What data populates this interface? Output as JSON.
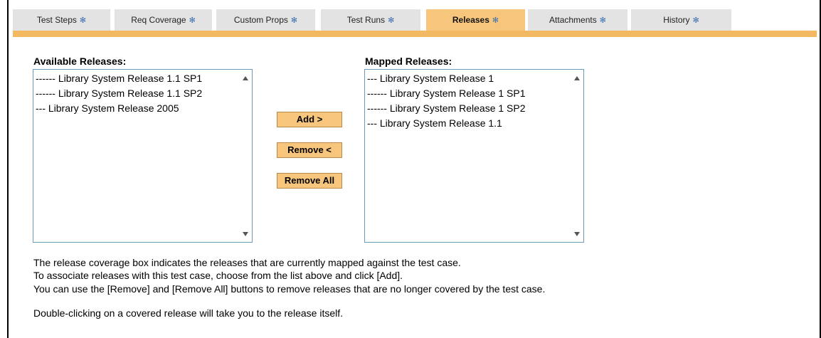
{
  "tabs": [
    {
      "label": "Test Steps",
      "active": false
    },
    {
      "label": "Req Coverage",
      "active": false
    },
    {
      "label": "Custom Props",
      "active": false
    },
    {
      "label": "Test Runs",
      "active": false
    },
    {
      "label": "Releases",
      "active": true
    },
    {
      "label": "Attachments",
      "active": false
    },
    {
      "label": "History",
      "active": false
    }
  ],
  "tab_marker": "✻",
  "available": {
    "label": "Available Releases:",
    "items": [
      "------ Library System Release 1.1 SP1",
      "------ Library System Release 1.1 SP2",
      "--- Library System Release 2005"
    ]
  },
  "mapped": {
    "label": "Mapped Releases:",
    "items": [
      "--- Library System Release 1",
      "------ Library System Release 1 SP1",
      "------ Library System Release 1 SP2",
      "--- Library System Release 1.1"
    ]
  },
  "buttons": {
    "add": "Add >",
    "remove": "Remove <",
    "remove_all": "Remove All"
  },
  "help": {
    "line1": "The release coverage box indicates the releases that are currently mapped against the test case.",
    "line2": "To associate releases with this test case, choose from the list above and click [Add].",
    "line3": "You can use the [Remove] and [Remove All] buttons to remove releases that are no longer covered by the test case.",
    "line4": "Double-clicking on a covered release will take you to the release itself."
  },
  "colors": {
    "accent": "#f7c67c",
    "strip": "#f3b862",
    "tab_inactive": "#e3e3e3",
    "listbox_border": "#6d9ab8",
    "tab_star": "#3a6fb0"
  }
}
